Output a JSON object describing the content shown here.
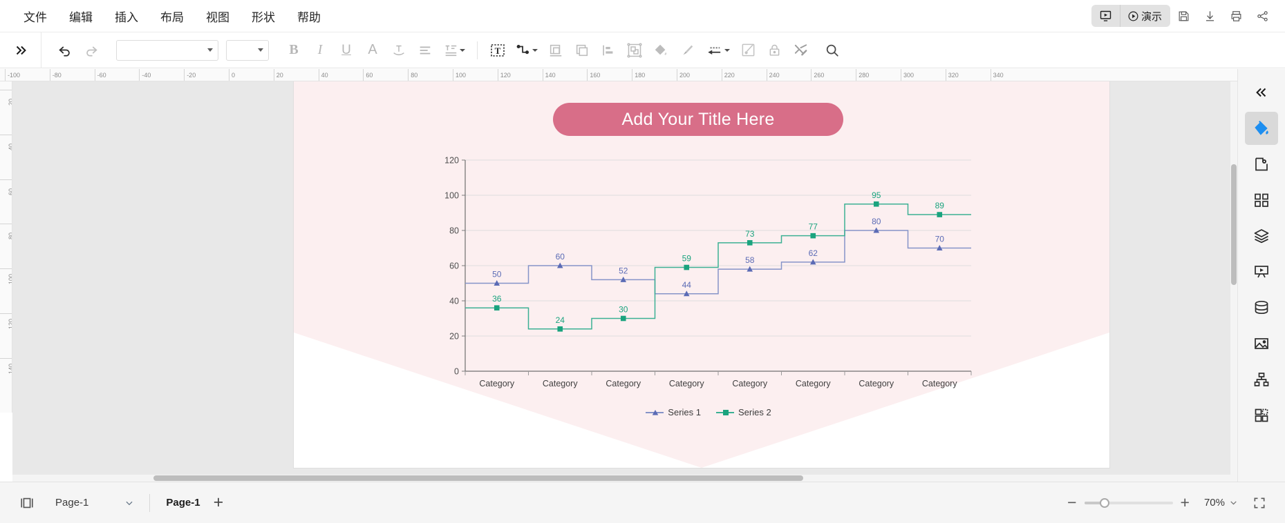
{
  "menu": {
    "items": [
      {
        "label": "文件",
        "name": "menu-file"
      },
      {
        "label": "编辑",
        "name": "menu-edit"
      },
      {
        "label": "插入",
        "name": "menu-insert"
      },
      {
        "label": "布局",
        "name": "menu-layout"
      },
      {
        "label": "视图",
        "name": "menu-view"
      },
      {
        "label": "形状",
        "name": "menu-shape"
      },
      {
        "label": "帮助",
        "name": "menu-help"
      }
    ],
    "present_label": "演示"
  },
  "toolbar": {
    "font_value": "",
    "font_placeholder": "",
    "size_value": "",
    "size_placeholder": ""
  },
  "rulers": {
    "h_ticks": [
      "-100",
      "-80",
      "-60",
      "-40",
      "-20",
      "0",
      "20",
      "40",
      "60",
      "80",
      "100",
      "120",
      "140",
      "160",
      "180",
      "200",
      "220",
      "240",
      "260",
      "280",
      "300",
      "320",
      "340"
    ],
    "v_ticks": [
      "20",
      "40",
      "60",
      "80",
      "100",
      "120",
      "140"
    ]
  },
  "slide": {
    "title": "Add Your Title Here",
    "title_bg": "#d86e88"
  },
  "chart_data": {
    "type": "line",
    "style": "step",
    "title": "Add Your Title Here",
    "categories": [
      "Category",
      "Category",
      "Category",
      "Category",
      "Category",
      "Category",
      "Category",
      "Category"
    ],
    "series": [
      {
        "name": "Series 1",
        "values": [
          50,
          60,
          52,
          44,
          58,
          62,
          80,
          70
        ],
        "color": "#8593c8",
        "marker": "triangle"
      },
      {
        "name": "Series 2",
        "values": [
          36,
          24,
          30,
          59,
          73,
          77,
          95,
          89
        ],
        "color": "#3bb093",
        "marker": "square"
      }
    ],
    "ylim": [
      0,
      120
    ],
    "yticks": [
      0,
      20,
      40,
      60,
      80,
      100,
      120
    ],
    "xlabel": "",
    "ylabel": "",
    "grid": true,
    "legend_position": "bottom",
    "data_labels": true,
    "plot_bg": "#fceff0"
  },
  "sidebar": {
    "items": [
      {
        "name": "collapse-panel-button",
        "icon": "chevron-double-left-icon"
      },
      {
        "name": "fill-style-panel-button",
        "icon": "paint-bucket-icon",
        "active": true
      },
      {
        "name": "page-settings-panel-button",
        "icon": "page-gear-icon"
      },
      {
        "name": "symbols-panel-button",
        "icon": "grid-blocks-icon"
      },
      {
        "name": "layers-panel-button",
        "icon": "layers-icon"
      },
      {
        "name": "presentation-panel-button",
        "icon": "presentation-screen-icon"
      },
      {
        "name": "data-panel-button",
        "icon": "database-icon"
      },
      {
        "name": "image-panel-button",
        "icon": "image-icon"
      },
      {
        "name": "org-chart-panel-button",
        "icon": "hierarchy-icon"
      },
      {
        "name": "template-panel-button",
        "icon": "puzzle-template-icon"
      }
    ]
  },
  "status": {
    "page_select_label": "Page-1",
    "page_tab_label": "Page-1",
    "add_page_label": "+",
    "zoom_level": "70%",
    "zoom_minus": "−",
    "zoom_plus": "+"
  }
}
